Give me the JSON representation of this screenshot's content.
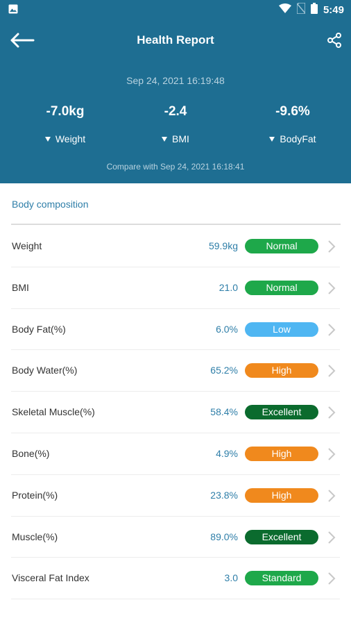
{
  "status_bar": {
    "time": "5:49"
  },
  "app_bar": {
    "title": "Health Report"
  },
  "report": {
    "date": "Sep 24, 2021 16:19:48",
    "compare_text": "Compare with Sep 24, 2021 16:18:41"
  },
  "metrics": [
    {
      "value": "-7.0kg",
      "label": "Weight"
    },
    {
      "value": "-2.4",
      "label": "BMI"
    },
    {
      "value": "-9.6%",
      "label": "BodyFat"
    }
  ],
  "section": {
    "title": "Body composition"
  },
  "rows": [
    {
      "label": "Weight",
      "value": "59.9kg",
      "status": "Normal",
      "status_color": "#1ea84a"
    },
    {
      "label": "BMI",
      "value": "21.0",
      "status": "Normal",
      "status_color": "#1ea84a"
    },
    {
      "label": "Body Fat(%)",
      "value": "6.0%",
      "status": "Low",
      "status_color": "#4fb6f2"
    },
    {
      "label": "Body Water(%)",
      "value": "65.2%",
      "status": "High",
      "status_color": "#f0891d"
    },
    {
      "label": "Skeletal Muscle(%)",
      "value": "58.4%",
      "status": "Excellent",
      "status_color": "#0b6b2e"
    },
    {
      "label": "Bone(%)",
      "value": "4.9%",
      "status": "High",
      "status_color": "#f0891d"
    },
    {
      "label": "Protein(%)",
      "value": "23.8%",
      "status": "High",
      "status_color": "#f0891d"
    },
    {
      "label": "Muscle(%)",
      "value": "89.0%",
      "status": "Excellent",
      "status_color": "#0b6b2e"
    },
    {
      "label": "Visceral Fat Index",
      "value": "3.0",
      "status": "Standard",
      "status_color": "#1ea84a"
    }
  ],
  "colors": {
    "header_bg": "#1e6e92",
    "accent_text": "#2e7ea8"
  },
  "icons": {
    "back": "arrow-left-icon",
    "share": "share-icon",
    "row_chevron": "chevron-right-icon",
    "metric_indicator": "triangle-down-icon"
  }
}
